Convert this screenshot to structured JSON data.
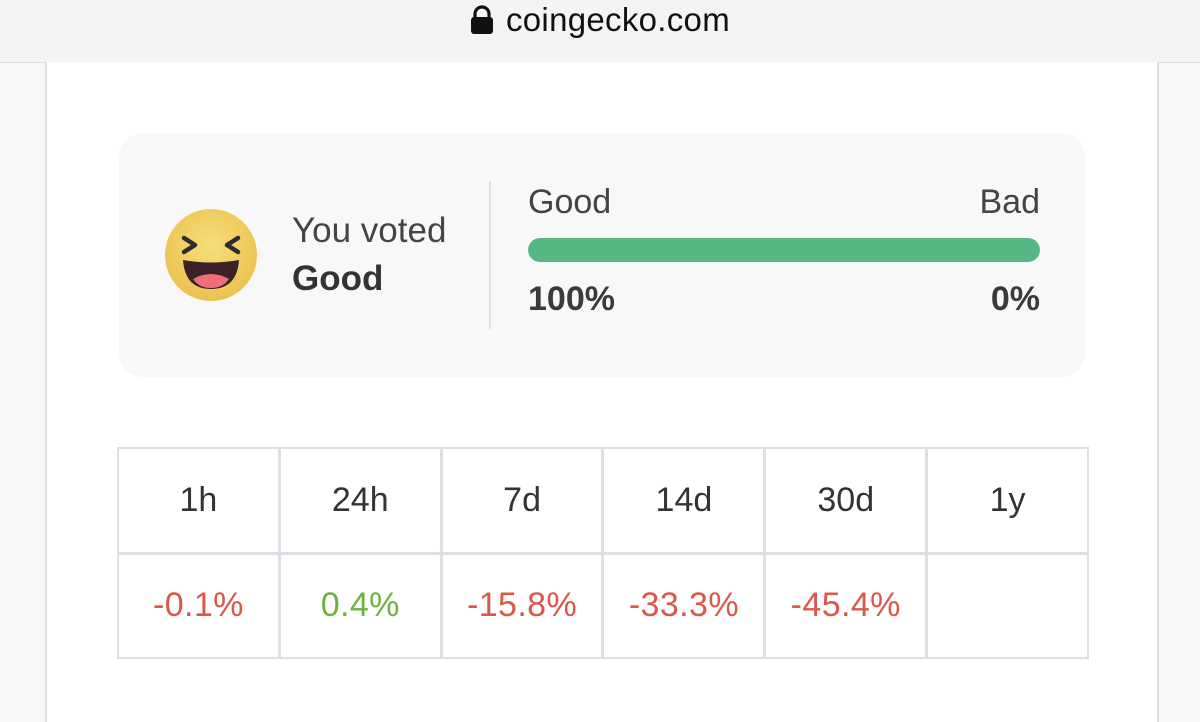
{
  "browser": {
    "url": "coingecko.com",
    "lock_icon": "lock-icon"
  },
  "vote": {
    "emoji_icon": "laughing-face-icon",
    "label": "You voted",
    "value": "Good"
  },
  "sentiment": {
    "good_label": "Good",
    "bad_label": "Bad",
    "good_pct": "100%",
    "bad_pct": "0%",
    "good_fraction": 1.0,
    "bar_color": "#55b882"
  },
  "performance": {
    "headers": [
      "1h",
      "24h",
      "7d",
      "14d",
      "30d",
      "1y"
    ],
    "values": [
      "-0.1%",
      "0.4%",
      "-15.8%",
      "-33.3%",
      "-45.4%",
      ""
    ],
    "colors": {
      "negative": "#d9584a",
      "positive": "#6fb13f"
    },
    "signs": [
      "negative",
      "positive",
      "negative",
      "negative",
      "negative",
      ""
    ]
  }
}
